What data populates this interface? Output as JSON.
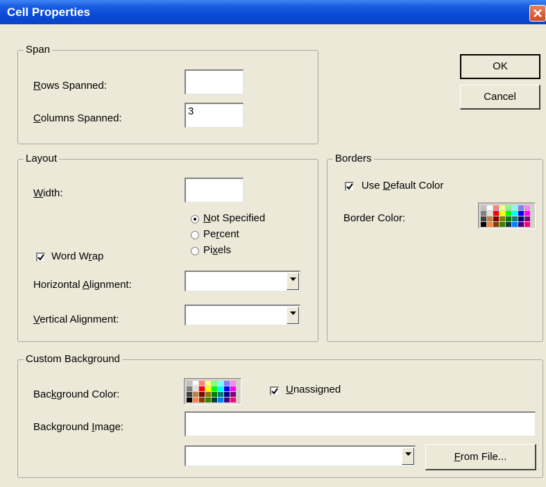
{
  "window": {
    "title": "Cell Properties"
  },
  "buttons": {
    "ok": "OK",
    "cancel": "Cancel",
    "from_file": "From File..."
  },
  "span": {
    "title": "Span",
    "rows_label": {
      "pre": "",
      "key": "R",
      "post": "ows Spanned:"
    },
    "rows_value": "",
    "cols_label": {
      "pre": "",
      "key": "C",
      "post": "olumns Spanned:"
    },
    "cols_value": "3"
  },
  "layout": {
    "title": "Layout",
    "width_label": {
      "pre": "",
      "key": "W",
      "post": "idth:"
    },
    "width_value": "",
    "radio": {
      "not_specified": {
        "pre": "",
        "key": "N",
        "post": "ot Specified",
        "checked": true
      },
      "percent": {
        "pre": "Pe",
        "key": "r",
        "post": "cent",
        "checked": false
      },
      "pixels": {
        "pre": "Pi",
        "key": "x",
        "post": "els",
        "checked": false
      }
    },
    "word_wrap": {
      "pre": "Word W",
      "key": "r",
      "post": "ap",
      "checked": true
    },
    "h_align_label": {
      "pre": "Horizontal ",
      "key": "A",
      "post": "lignment:"
    },
    "h_align_value": "",
    "v_align_label": {
      "pre": "",
      "key": "V",
      "post": "ertical Alignment:"
    },
    "v_align_value": ""
  },
  "borders": {
    "title": "Borders",
    "use_default": {
      "pre": "Use ",
      "key": "D",
      "post": "efault Color",
      "checked": true
    },
    "border_color_label": "Border Color:"
  },
  "background": {
    "title": "Custom Background",
    "color_label": {
      "pre": "Bac",
      "key": "k",
      "post": "ground Color:"
    },
    "unassigned": {
      "pre": "",
      "key": "U",
      "post": "nassigned",
      "checked": true
    },
    "image_label": {
      "pre": "Background ",
      "key": "I",
      "post": "mage:"
    },
    "image_value": "",
    "image_combo_value": ""
  },
  "palette": [
    "#c0c0c0",
    "#ffffff",
    "#ff8080",
    "#ffff80",
    "#80ff80",
    "#80ffff",
    "#8080ff",
    "#ff80ff",
    "#808080",
    "#e0e0e0",
    "#ff0000",
    "#ffff00",
    "#00ff00",
    "#00ffff",
    "#0000ff",
    "#ff00ff",
    "#404040",
    "#c08040",
    "#800000",
    "#808000",
    "#008000",
    "#008080",
    "#000080",
    "#800080",
    "#000000",
    "#ff8040",
    "#804000",
    "#408000",
    "#004040",
    "#0080ff",
    "#400080",
    "#ff0080"
  ]
}
